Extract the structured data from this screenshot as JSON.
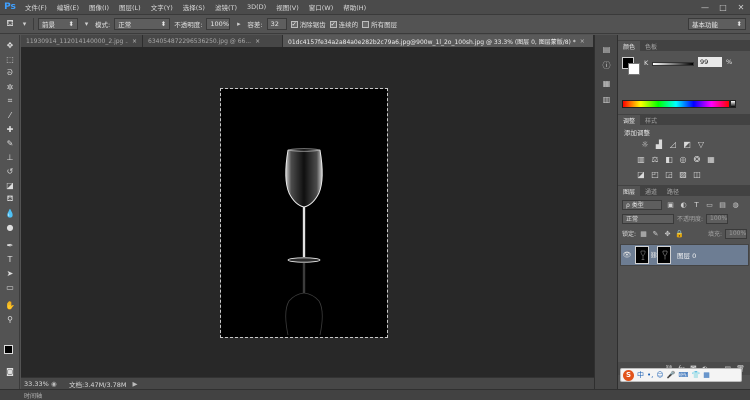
{
  "menubar": {
    "logo": "Ps",
    "items": [
      "文件(F)",
      "编辑(E)",
      "图像(I)",
      "图层(L)",
      "文字(Y)",
      "选择(S)",
      "滤镜(T)",
      "3D(D)",
      "视图(V)",
      "窗口(W)",
      "帮助(H)"
    ],
    "window_controls": [
      "—",
      "□",
      "✕"
    ]
  },
  "options": {
    "sample_value": "前景",
    "mode_label": "模式:",
    "mode_value": "正常",
    "opacity_label": "不透明度:",
    "opacity_value": "100%",
    "tolerance_label": "容差:",
    "tolerance_value": "32",
    "anti_alias_label": "消除锯齿",
    "contiguous_label": "连续的",
    "all_layers_label": "所有图层",
    "workspace_value": "基本功能"
  },
  "tabs": [
    {
      "label": "11930914_112014140000_2.jpg ...",
      "close": "×"
    },
    {
      "label": "6340548722965362​50.jpg @ 66...",
      "close": "×"
    },
    {
      "label": "01dc4157fe34a2a84a0e282b2c79a6.jpg@900w_1l_2o_100sh.jpg @ 33.3% (图层 0, 图层蒙版/8) *",
      "close": "×"
    }
  ],
  "status": {
    "zoom": "33.33%",
    "doc_size": "文档:3.47M/3.78M",
    "arrow": "▶"
  },
  "timeline": {
    "label": "时间轴"
  },
  "color_panel": {
    "tabs": [
      "颜色",
      "色板"
    ],
    "k_label": "K",
    "k_value": "99",
    "k_unit": "%"
  },
  "adjustments_panel": {
    "tabs": [
      "调整",
      "样式"
    ],
    "title": "添加调整"
  },
  "layers_panel": {
    "tabs": [
      "图层",
      "通道",
      "路径"
    ],
    "filter_kind": "ρ 类型",
    "blend_mode": "正常",
    "opacity_label": "不透明度:",
    "opacity_value": "100%",
    "lock_label": "锁定:",
    "fill_label": "填充:",
    "fill_value": "100%",
    "layer_name": "图层 0"
  },
  "ime": {
    "logo": "S",
    "items": [
      "中",
      "•,",
      "☺",
      "🎤",
      "⌨",
      "👕",
      "▦"
    ]
  },
  "colors": {
    "accent_blue": "#3fa0ff",
    "selected_layer": "#6d7d93",
    "canvas_bg": "#282828"
  }
}
